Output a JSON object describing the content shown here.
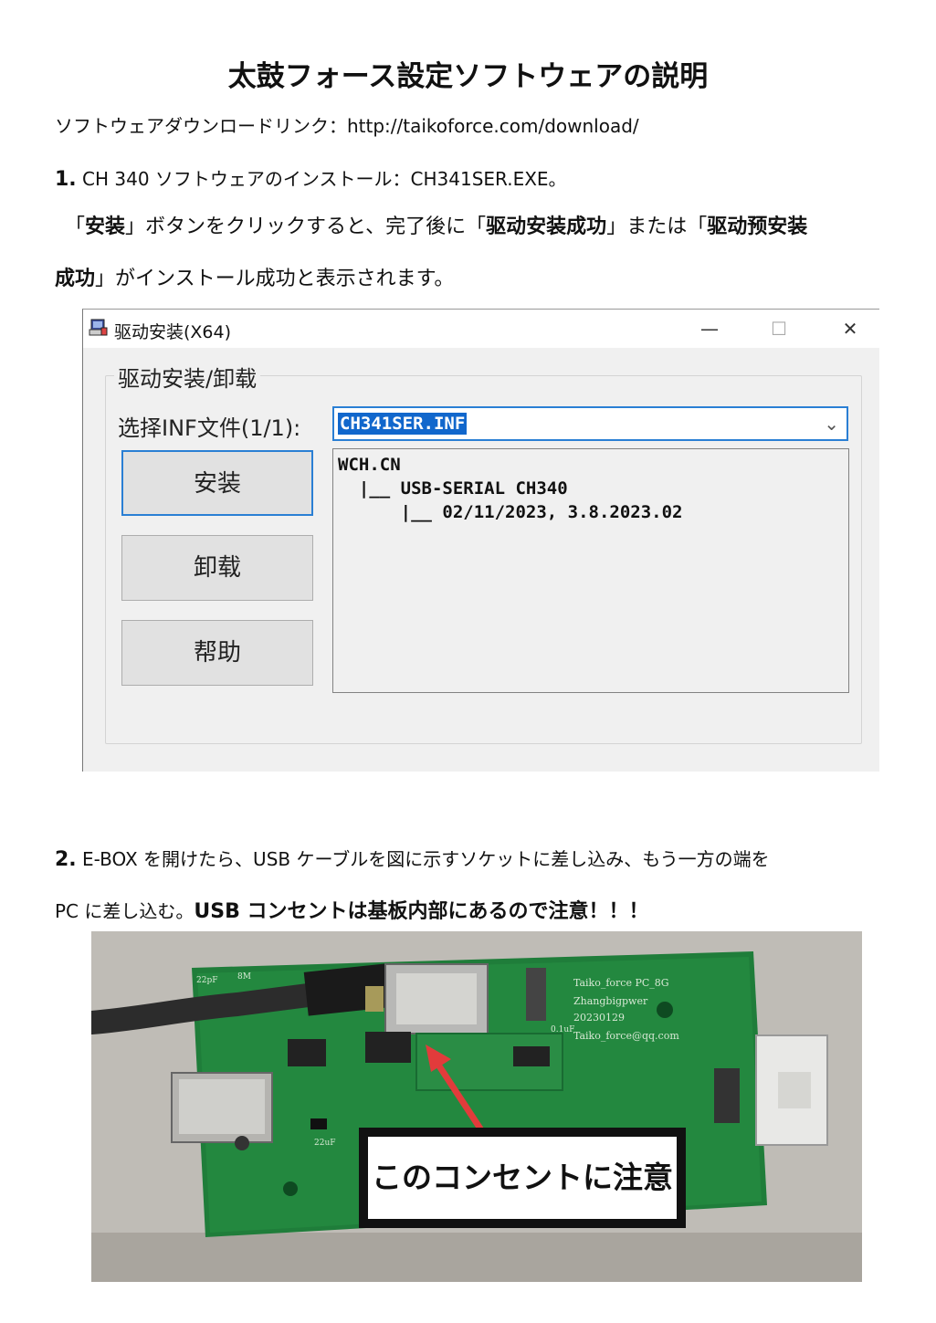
{
  "title": "太鼓フォース設定ソフトウェアの説明",
  "download_line": "ソフトウェアダウンロードリンク：http://taikoforce.com/download/",
  "step1": {
    "number": "1.",
    "text": " CH 340 ソフトウェアのインストール：CH341SER.EXE。",
    "para_a1": "「",
    "para_b1": "安装",
    "para_a2": "」ボタンをクリックすると、完了後に「",
    "para_b2": "驱动安装成功",
    "para_a3": "」または「",
    "para_b3": "驱动预安装",
    "para_b4": "成功",
    "para_a4": "」がインストール成功と表示されます。"
  },
  "dialog": {
    "title": "驱动安装(X64)",
    "minimize": "—",
    "maximize": "☐",
    "close": "✕",
    "group_label": "驱动安装/卸载",
    "inf_label": "选择INF文件(1/1):",
    "inf_value": "CH341SER.INF",
    "dropdown_arrow": "⌄",
    "buttons": {
      "install": "安装",
      "uninstall": "卸载",
      "help": "帮助"
    },
    "tree": [
      "WCH.CN",
      "  |__ USB-SERIAL CH340",
      "      |__ 02/11/2023, 3.8.2023.02"
    ]
  },
  "step2": {
    "number": "2.",
    "text": " E-BOX を開けたら、USB ケーブルを図に示すソケットに差し込み、もう一方の端を",
    "line2_normal": "PC に差し込む。",
    "line2_bold": "USB コンセントは基板内部にあるので注意！！！"
  },
  "photo": {
    "callout": "このコンセントに注意",
    "board_labels": [
      "Taiko_force PC_8G",
      "Zhangbigpwer",
      "20230129",
      "Taiko_force@qq.com",
      "0.1uF",
      "22uF",
      "22pF",
      "8M"
    ],
    "colors": {
      "pcb": "#1f7d3a",
      "arrow": "#e23b3b"
    }
  }
}
